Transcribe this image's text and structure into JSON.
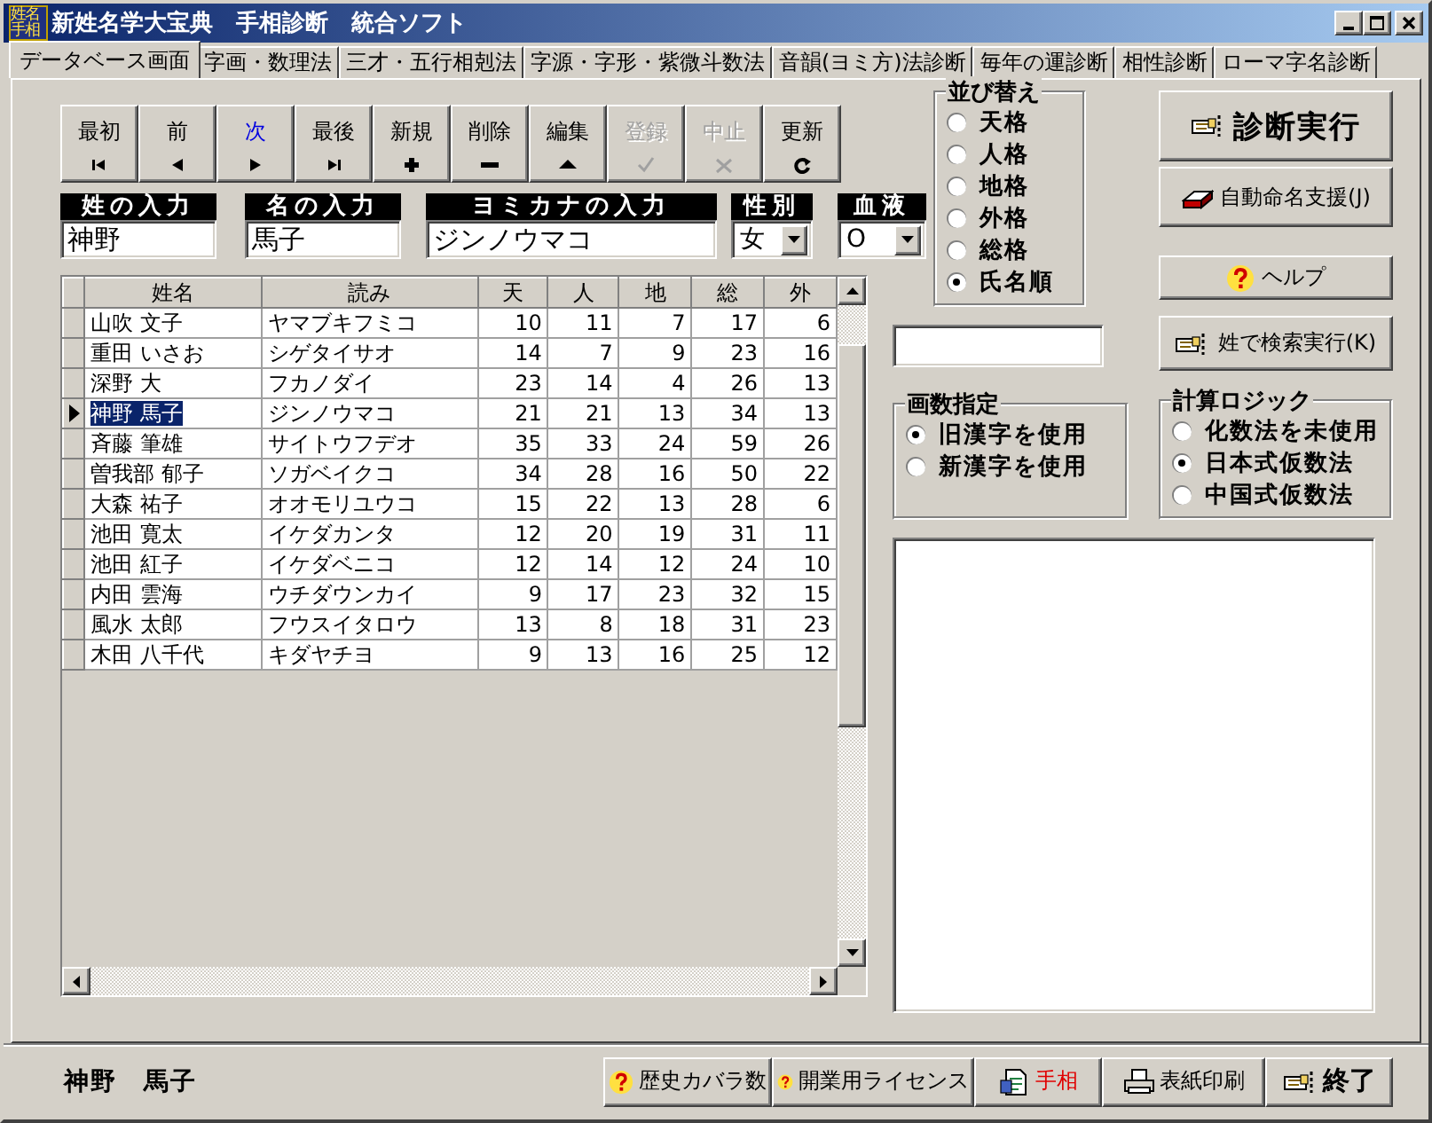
{
  "window": {
    "title": "新姓名学大宝典　手相診断　統合ソフト",
    "icon_text": [
      "姓名",
      "手相"
    ]
  },
  "tabs": [
    {
      "label": "データベース画面",
      "selected": true
    },
    {
      "label": "字画・数理法",
      "selected": false
    },
    {
      "label": "三才・五行相剋法",
      "selected": false
    },
    {
      "label": "字源・字形・紫微斗数法",
      "selected": false
    },
    {
      "label": "音韻(ヨミ方)法診断",
      "selected": false
    },
    {
      "label": "毎年の運診断",
      "selected": false
    },
    {
      "label": "相性診断",
      "selected": false
    },
    {
      "label": "ローマ字名診断",
      "selected": false
    }
  ],
  "nav_buttons": [
    {
      "label": "最初",
      "kind": "first",
      "disabled": false,
      "focused": false
    },
    {
      "label": "前",
      "kind": "prev",
      "disabled": false,
      "focused": false
    },
    {
      "label": "次",
      "kind": "next",
      "disabled": false,
      "focused": true
    },
    {
      "label": "最後",
      "kind": "last",
      "disabled": false,
      "focused": false
    },
    {
      "label": "新規",
      "kind": "add",
      "disabled": false,
      "focused": false
    },
    {
      "label": "削除",
      "kind": "delete",
      "disabled": false,
      "focused": false
    },
    {
      "label": "編集",
      "kind": "edit",
      "disabled": false,
      "focused": false
    },
    {
      "label": "登録",
      "kind": "post",
      "disabled": true,
      "focused": false
    },
    {
      "label": "中止",
      "kind": "cancel",
      "disabled": true,
      "focused": false
    },
    {
      "label": "更新",
      "kind": "refresh",
      "disabled": false,
      "focused": false
    }
  ],
  "fields": [
    {
      "label": "姓の入力",
      "value": "神野",
      "kind": "text"
    },
    {
      "label": "名の入力",
      "value": "馬子",
      "kind": "text"
    },
    {
      "label": "ヨミカナの入力",
      "value": "ジンノウマコ",
      "kind": "text"
    },
    {
      "label": "性別",
      "value": "女",
      "kind": "dropdown"
    },
    {
      "label": "血液",
      "value": "O",
      "kind": "dropdown"
    }
  ],
  "table": {
    "columns": [
      "姓名",
      "読み",
      "天",
      "人",
      "地",
      "総",
      "外"
    ],
    "rows": [
      {
        "cells": [
          "山吹 文子",
          "ヤマブキフミコ",
          "10",
          "11",
          "7",
          "17",
          "6"
        ],
        "selected": false
      },
      {
        "cells": [
          "重田 いさお",
          "シゲタイサオ",
          "14",
          "7",
          "9",
          "23",
          "16"
        ],
        "selected": false
      },
      {
        "cells": [
          "深野 大",
          "フカノダイ",
          "23",
          "14",
          "4",
          "26",
          "13"
        ],
        "selected": false
      },
      {
        "cells": [
          "神野 馬子",
          "ジンノウマコ",
          "21",
          "21",
          "13",
          "34",
          "13"
        ],
        "selected": true
      },
      {
        "cells": [
          "斉藤 筆雄",
          "サイトウフデオ",
          "35",
          "33",
          "24",
          "59",
          "26"
        ],
        "selected": false
      },
      {
        "cells": [
          "曽我部 郁子",
          "ソガベイクコ",
          "34",
          "28",
          "16",
          "50",
          "22"
        ],
        "selected": false
      },
      {
        "cells": [
          "大森 祐子",
          "オオモリユウコ",
          "15",
          "22",
          "13",
          "28",
          "6"
        ],
        "selected": false
      },
      {
        "cells": [
          "池田 寛太",
          "イケダカンタ",
          "12",
          "20",
          "19",
          "31",
          "11"
        ],
        "selected": false
      },
      {
        "cells": [
          "池田 紅子",
          "イケダベニコ",
          "12",
          "14",
          "12",
          "24",
          "10"
        ],
        "selected": false
      },
      {
        "cells": [
          "内田 雲海",
          "ウチダウンカイ",
          "9",
          "17",
          "23",
          "32",
          "15"
        ],
        "selected": false
      },
      {
        "cells": [
          "風水 太郎",
          "フウスイタロウ",
          "13",
          "8",
          "18",
          "31",
          "23"
        ],
        "selected": false
      },
      {
        "cells": [
          "木田 八千代",
          "キダヤチヨ",
          "9",
          "13",
          "16",
          "25",
          "12"
        ],
        "selected": false
      }
    ]
  },
  "sort_group": {
    "title": "並び替え",
    "options": [
      {
        "label": "天格",
        "selected": false
      },
      {
        "label": "人格",
        "selected": false
      },
      {
        "label": "地格",
        "selected": false
      },
      {
        "label": "外格",
        "selected": false
      },
      {
        "label": "総格",
        "selected": false
      },
      {
        "label": "氏名順",
        "selected": true
      }
    ]
  },
  "action_buttons": [
    {
      "label": "診断実行",
      "kind": "run"
    },
    {
      "label": "自動命名支援(J)",
      "kind": "auto"
    },
    {
      "label": "ヘルプ",
      "kind": "help"
    },
    {
      "label": "姓で検索実行(K)",
      "kind": "search"
    }
  ],
  "stroke_group": {
    "title": "画数指定",
    "options": [
      {
        "label": "旧漢字を使用",
        "selected": true
      },
      {
        "label": "新漢字を使用",
        "selected": false
      }
    ]
  },
  "logic_group": {
    "title": "計算ロジック",
    "options": [
      {
        "label": "化数法を未使用",
        "selected": false
      },
      {
        "label": "日本式仮数法",
        "selected": true
      },
      {
        "label": "中国式仮数法",
        "selected": false
      }
    ]
  },
  "footer": {
    "name": "神野　馬子",
    "buttons": [
      {
        "label": "歴史カバラ数",
        "kind": "help",
        "emphasis": false
      },
      {
        "label": "開業用ライセンス",
        "kind": "help",
        "emphasis": false
      },
      {
        "label": "手相",
        "kind": "palm",
        "emphasis": true
      },
      {
        "label": "表紙印刷",
        "kind": "print",
        "emphasis": false
      },
      {
        "label": "終了",
        "kind": "exit",
        "emphasis": false
      }
    ]
  }
}
